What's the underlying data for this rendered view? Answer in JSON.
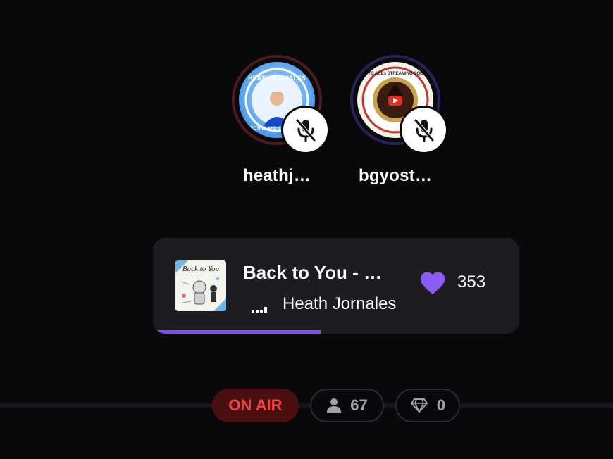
{
  "speakers": [
    {
      "name": "heathj…",
      "avatar_text": "HEATH JORNALES",
      "avatar_subtext": "VOTING AND STREAMING",
      "muted": true,
      "ring_color": "#4a1a1c"
    },
    {
      "name": "bgyost…",
      "avatar_text": "BGYO ACEs STREAMING SQUAD",
      "muted": true,
      "ring_color": "#2c1f55"
    }
  ],
  "now_playing": {
    "album_art_text": "Back to You",
    "title": "Back to You - …",
    "artist": "Heath Jornales",
    "like_count": "353",
    "progress": 0.46,
    "accent_color": "#7c4dff"
  },
  "status": {
    "on_air_label": "ON AIR",
    "listener_count": "67",
    "gem_count": "0",
    "on_air_color": "#ef4444"
  },
  "icons": [
    "mic-off-icon",
    "heart-icon",
    "person-icon",
    "diamond-icon",
    "equalizer-icon"
  ]
}
